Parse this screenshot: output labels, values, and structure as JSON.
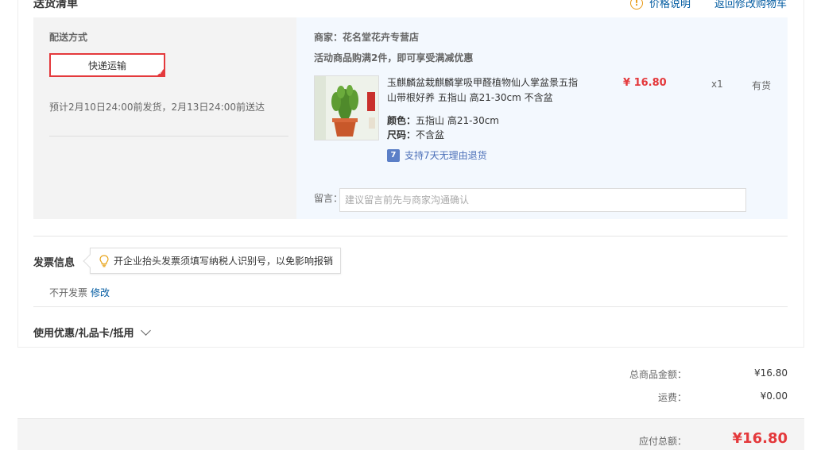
{
  "header": {
    "section_title": "送货清单",
    "price_note_label": "价格说明",
    "back_to_cart_label": "返回修改购物车"
  },
  "shipping": {
    "method_label": "配送方式",
    "selected_option": "快递运输",
    "estimate": "预计2月10日24:00前发货，2月13日24:00前送达"
  },
  "merchant": {
    "label": "商家：",
    "name": "花名堂花卉专营店",
    "promo": "活动商品购满2件，即可享受满减优惠"
  },
  "product": {
    "name": "玉麒麟盆栽麒麟掌吸甲醛植物仙人掌盆景五指山带根好养 五指山 高21-30cm 不含盆",
    "color_label": "颜色：",
    "color_value": "五指山 高21-30cm",
    "size_label": "尺码：",
    "size_value": "不含盆",
    "return_policy": "支持7天无理由退货",
    "return_icon_text": "7",
    "price": "¥ 16.80",
    "quantity": "x1",
    "stock": "有货"
  },
  "message": {
    "label": "留言：",
    "placeholder": "建议留言前先与商家沟通确认"
  },
  "invoice": {
    "title": "发票信息",
    "tip": "开企业抬头发票须填写纳税人识别号，以免影响报销",
    "value": "不开发票",
    "edit_label": "修改"
  },
  "coupon": {
    "label": "使用优惠/礼品卡/抵用"
  },
  "summary": {
    "goods_total_label": "总商品金额：",
    "goods_total_value": "¥16.80",
    "shipping_fee_label": "运费：",
    "shipping_fee_value": "¥0.00",
    "payable_label": "应付总额：",
    "payable_value": "¥16.80"
  },
  "icons": {
    "price_note": "warning-circle-icon",
    "tip": "lightbulb-icon",
    "return": "seven-day-return-icon",
    "coupon_expand": "chevron-down-icon"
  },
  "colors": {
    "accent_red": "#e4393c",
    "link_blue": "#005aa0",
    "shipping_bg": "#f3f3f3",
    "merchant_bg": "#f3f8fe"
  }
}
